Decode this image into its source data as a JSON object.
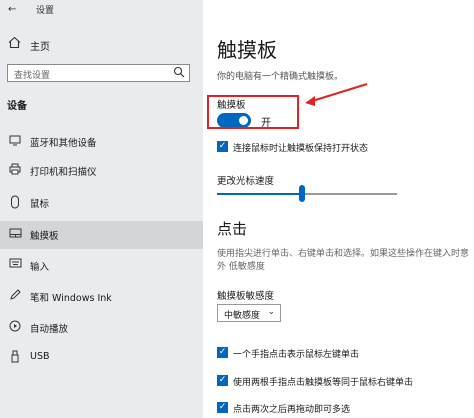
{
  "app": {
    "title": "设置"
  },
  "sidebar": {
    "home_label": "主页",
    "search_placeholder": "查找设置",
    "section_label": "设备",
    "items": [
      {
        "label": "蓝牙和其他设备",
        "icon": "bluetooth-icon"
      },
      {
        "label": "打印机和扫描仪",
        "icon": "printer-icon"
      },
      {
        "label": "鼠标",
        "icon": "mouse-icon"
      },
      {
        "label": "触摸板",
        "icon": "touchpad-icon",
        "active": true
      },
      {
        "label": "输入",
        "icon": "keyboard-icon"
      },
      {
        "label": "笔和 Windows Ink",
        "icon": "pen-icon"
      },
      {
        "label": "自动播放",
        "icon": "autoplay-icon"
      },
      {
        "label": "USB",
        "icon": "usb-icon"
      }
    ]
  },
  "main": {
    "title": "触摸板",
    "description": "你的电脑有一个精确式触摸板。",
    "touchpad_label": "触摸板",
    "toggle_state": "开",
    "keep_on_with_mouse": "连接鼠标时让触摸板保持打开状态",
    "speed_label": "更改光标速度",
    "speed_value": 0.47,
    "click_title": "点击",
    "click_desc": "使用指尖进行单击、右键单击和选择。如果这些操作在键入时意外 低敏感度",
    "sensitivity_label": "触摸板敏感度",
    "sensitivity_value": "中敏感度",
    "options": [
      "一个手指点击表示鼠标左键单击",
      "使用两根手指点击触摸板等同于鼠标右键单击",
      "点击两次之后再拖动即可多选"
    ]
  },
  "colors": {
    "accent": "#0067c0",
    "highlight": "#e02424"
  }
}
